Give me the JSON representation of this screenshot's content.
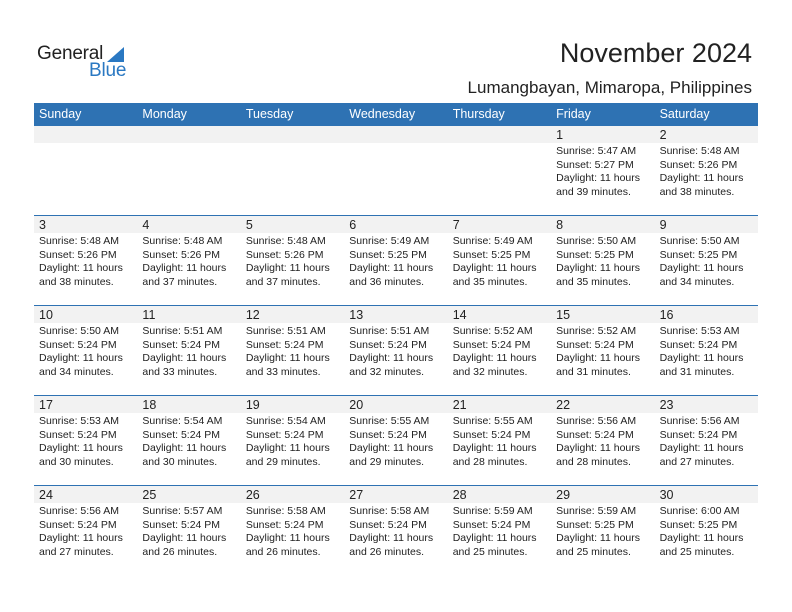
{
  "brand": {
    "line1": "General",
    "line2": "Blue",
    "accent_color": "#2a78c2"
  },
  "header": {
    "title": "November 2024",
    "location": "Lumangbayan, Mimaropa, Philippines"
  },
  "colors": {
    "header_bg": "#2e72b3",
    "day_band_bg": "#f2f2f2"
  },
  "weekdays": [
    "Sunday",
    "Monday",
    "Tuesday",
    "Wednesday",
    "Thursday",
    "Friday",
    "Saturday"
  ],
  "weeks": [
    [
      null,
      null,
      null,
      null,
      null,
      {
        "day": "1",
        "sunrise": "Sunrise: 5:47 AM",
        "sunset": "Sunset: 5:27 PM",
        "daylight1": "Daylight: 11 hours",
        "daylight2": "and 39 minutes."
      },
      {
        "day": "2",
        "sunrise": "Sunrise: 5:48 AM",
        "sunset": "Sunset: 5:26 PM",
        "daylight1": "Daylight: 11 hours",
        "daylight2": "and 38 minutes."
      }
    ],
    [
      {
        "day": "3",
        "sunrise": "Sunrise: 5:48 AM",
        "sunset": "Sunset: 5:26 PM",
        "daylight1": "Daylight: 11 hours",
        "daylight2": "and 38 minutes."
      },
      {
        "day": "4",
        "sunrise": "Sunrise: 5:48 AM",
        "sunset": "Sunset: 5:26 PM",
        "daylight1": "Daylight: 11 hours",
        "daylight2": "and 37 minutes."
      },
      {
        "day": "5",
        "sunrise": "Sunrise: 5:48 AM",
        "sunset": "Sunset: 5:26 PM",
        "daylight1": "Daylight: 11 hours",
        "daylight2": "and 37 minutes."
      },
      {
        "day": "6",
        "sunrise": "Sunrise: 5:49 AM",
        "sunset": "Sunset: 5:25 PM",
        "daylight1": "Daylight: 11 hours",
        "daylight2": "and 36 minutes."
      },
      {
        "day": "7",
        "sunrise": "Sunrise: 5:49 AM",
        "sunset": "Sunset: 5:25 PM",
        "daylight1": "Daylight: 11 hours",
        "daylight2": "and 35 minutes."
      },
      {
        "day": "8",
        "sunrise": "Sunrise: 5:50 AM",
        "sunset": "Sunset: 5:25 PM",
        "daylight1": "Daylight: 11 hours",
        "daylight2": "and 35 minutes."
      },
      {
        "day": "9",
        "sunrise": "Sunrise: 5:50 AM",
        "sunset": "Sunset: 5:25 PM",
        "daylight1": "Daylight: 11 hours",
        "daylight2": "and 34 minutes."
      }
    ],
    [
      {
        "day": "10",
        "sunrise": "Sunrise: 5:50 AM",
        "sunset": "Sunset: 5:24 PM",
        "daylight1": "Daylight: 11 hours",
        "daylight2": "and 34 minutes."
      },
      {
        "day": "11",
        "sunrise": "Sunrise: 5:51 AM",
        "sunset": "Sunset: 5:24 PM",
        "daylight1": "Daylight: 11 hours",
        "daylight2": "and 33 minutes."
      },
      {
        "day": "12",
        "sunrise": "Sunrise: 5:51 AM",
        "sunset": "Sunset: 5:24 PM",
        "daylight1": "Daylight: 11 hours",
        "daylight2": "and 33 minutes."
      },
      {
        "day": "13",
        "sunrise": "Sunrise: 5:51 AM",
        "sunset": "Sunset: 5:24 PM",
        "daylight1": "Daylight: 11 hours",
        "daylight2": "and 32 minutes."
      },
      {
        "day": "14",
        "sunrise": "Sunrise: 5:52 AM",
        "sunset": "Sunset: 5:24 PM",
        "daylight1": "Daylight: 11 hours",
        "daylight2": "and 32 minutes."
      },
      {
        "day": "15",
        "sunrise": "Sunrise: 5:52 AM",
        "sunset": "Sunset: 5:24 PM",
        "daylight1": "Daylight: 11 hours",
        "daylight2": "and 31 minutes."
      },
      {
        "day": "16",
        "sunrise": "Sunrise: 5:53 AM",
        "sunset": "Sunset: 5:24 PM",
        "daylight1": "Daylight: 11 hours",
        "daylight2": "and 31 minutes."
      }
    ],
    [
      {
        "day": "17",
        "sunrise": "Sunrise: 5:53 AM",
        "sunset": "Sunset: 5:24 PM",
        "daylight1": "Daylight: 11 hours",
        "daylight2": "and 30 minutes."
      },
      {
        "day": "18",
        "sunrise": "Sunrise: 5:54 AM",
        "sunset": "Sunset: 5:24 PM",
        "daylight1": "Daylight: 11 hours",
        "daylight2": "and 30 minutes."
      },
      {
        "day": "19",
        "sunrise": "Sunrise: 5:54 AM",
        "sunset": "Sunset: 5:24 PM",
        "daylight1": "Daylight: 11 hours",
        "daylight2": "and 29 minutes."
      },
      {
        "day": "20",
        "sunrise": "Sunrise: 5:55 AM",
        "sunset": "Sunset: 5:24 PM",
        "daylight1": "Daylight: 11 hours",
        "daylight2": "and 29 minutes."
      },
      {
        "day": "21",
        "sunrise": "Sunrise: 5:55 AM",
        "sunset": "Sunset: 5:24 PM",
        "daylight1": "Daylight: 11 hours",
        "daylight2": "and 28 minutes."
      },
      {
        "day": "22",
        "sunrise": "Sunrise: 5:56 AM",
        "sunset": "Sunset: 5:24 PM",
        "daylight1": "Daylight: 11 hours",
        "daylight2": "and 28 minutes."
      },
      {
        "day": "23",
        "sunrise": "Sunrise: 5:56 AM",
        "sunset": "Sunset: 5:24 PM",
        "daylight1": "Daylight: 11 hours",
        "daylight2": "and 27 minutes."
      }
    ],
    [
      {
        "day": "24",
        "sunrise": "Sunrise: 5:56 AM",
        "sunset": "Sunset: 5:24 PM",
        "daylight1": "Daylight: 11 hours",
        "daylight2": "and 27 minutes."
      },
      {
        "day": "25",
        "sunrise": "Sunrise: 5:57 AM",
        "sunset": "Sunset: 5:24 PM",
        "daylight1": "Daylight: 11 hours",
        "daylight2": "and 26 minutes."
      },
      {
        "day": "26",
        "sunrise": "Sunrise: 5:58 AM",
        "sunset": "Sunset: 5:24 PM",
        "daylight1": "Daylight: 11 hours",
        "daylight2": "and 26 minutes."
      },
      {
        "day": "27",
        "sunrise": "Sunrise: 5:58 AM",
        "sunset": "Sunset: 5:24 PM",
        "daylight1": "Daylight: 11 hours",
        "daylight2": "and 26 minutes."
      },
      {
        "day": "28",
        "sunrise": "Sunrise: 5:59 AM",
        "sunset": "Sunset: 5:24 PM",
        "daylight1": "Daylight: 11 hours",
        "daylight2": "and 25 minutes."
      },
      {
        "day": "29",
        "sunrise": "Sunrise: 5:59 AM",
        "sunset": "Sunset: 5:25 PM",
        "daylight1": "Daylight: 11 hours",
        "daylight2": "and 25 minutes."
      },
      {
        "day": "30",
        "sunrise": "Sunrise: 6:00 AM",
        "sunset": "Sunset: 5:25 PM",
        "daylight1": "Daylight: 11 hours",
        "daylight2": "and 25 minutes."
      }
    ]
  ]
}
